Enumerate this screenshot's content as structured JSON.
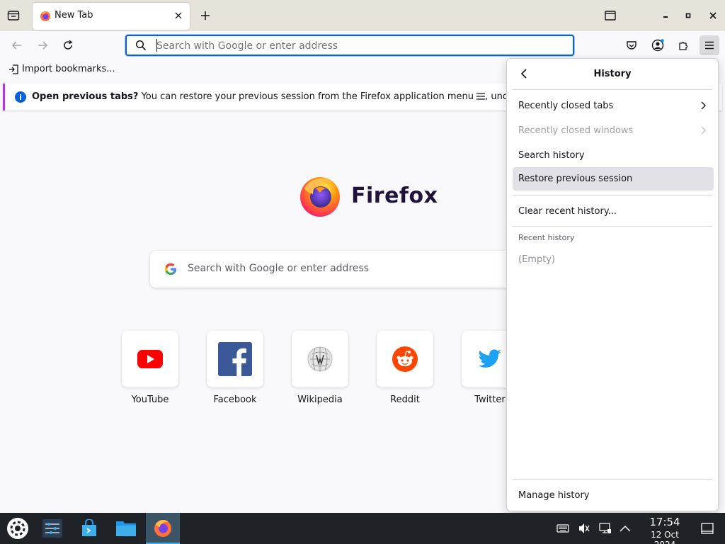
{
  "browser": {
    "tab_title": "New Tab",
    "urlbar_placeholder": "Search with Google or enter address"
  },
  "bookmarks": {
    "import_label": "Import bookmarks..."
  },
  "notice": {
    "bold": "Open previous tabs?",
    "text": " You can restore your previous session from the Firefox application menu ",
    "tail": ", under Hi"
  },
  "content": {
    "logo_word": "Firefox",
    "search_placeholder": "Search with Google or enter address",
    "tiles": [
      {
        "label": "YouTube"
      },
      {
        "label": "Facebook"
      },
      {
        "label": "Wikipedia"
      },
      {
        "label": "Reddit"
      },
      {
        "label": "Twitter"
      }
    ]
  },
  "history_panel": {
    "title": "History",
    "items": [
      {
        "label": "Recently closed tabs",
        "enabled": true
      },
      {
        "label": "Recently closed windows",
        "enabled": false
      },
      {
        "label": "Search history",
        "enabled": true
      },
      {
        "label": "Restore previous session",
        "enabled": true,
        "highlighted": true
      },
      {
        "label": "Clear recent history...",
        "enabled": true
      }
    ],
    "recent_caption": "Recent history",
    "empty_label": "(Empty)",
    "manage_label": "Manage history"
  },
  "taskbar": {
    "time": "17:54",
    "date": "12 Oct 2024"
  },
  "colors": {
    "accent": "#0061e0",
    "notice_stripe": "#b833e1",
    "taskbar_bg": "#1f2327"
  }
}
